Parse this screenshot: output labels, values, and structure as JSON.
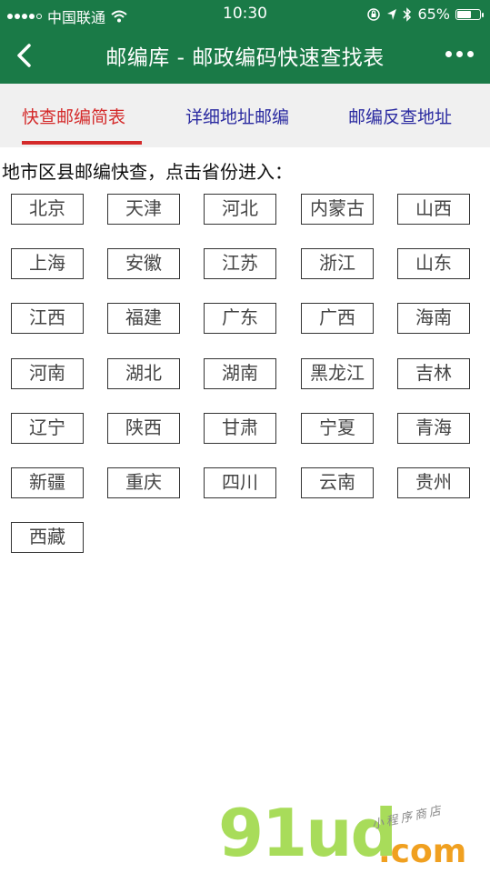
{
  "status_bar": {
    "carrier": "中国联通",
    "time": "10:30",
    "battery_percent": "65%",
    "battery_level": 0.65,
    "icons": [
      "signal-dots",
      "wifi-icon",
      "orientation-lock-icon",
      "location-icon",
      "bluetooth-icon",
      "battery-icon"
    ]
  },
  "nav": {
    "title": "邮编库 - 邮政编码快速查找表",
    "icons": [
      "back-chevron-icon",
      "more-dots-icon"
    ]
  },
  "tabs": [
    {
      "label": "快查邮编简表",
      "active": true
    },
    {
      "label": "详细地址邮编",
      "active": false
    },
    {
      "label": "邮编反查地址",
      "active": false
    }
  ],
  "intro": "地市区县邮编快查，点击省份进入：",
  "provinces": [
    "北京",
    "天津",
    "河北",
    "内蒙古",
    "山西",
    "上海",
    "安徽",
    "江苏",
    "浙江",
    "山东",
    "江西",
    "福建",
    "广东",
    "广西",
    "海南",
    "河南",
    "湖北",
    "湖南",
    "黑龙江",
    "吉林",
    "辽宁",
    "陕西",
    "甘肃",
    "宁夏",
    "青海",
    "新疆",
    "重庆",
    "四川",
    "云南",
    "贵州",
    "西藏"
  ],
  "watermark": {
    "main": "91ud",
    "suffix": ".com",
    "small": "小程序商店"
  },
  "colors": {
    "header_green": "#1a7a47",
    "active_tab_red": "#d42a2a",
    "tab_blue": "#2a2aa0"
  }
}
